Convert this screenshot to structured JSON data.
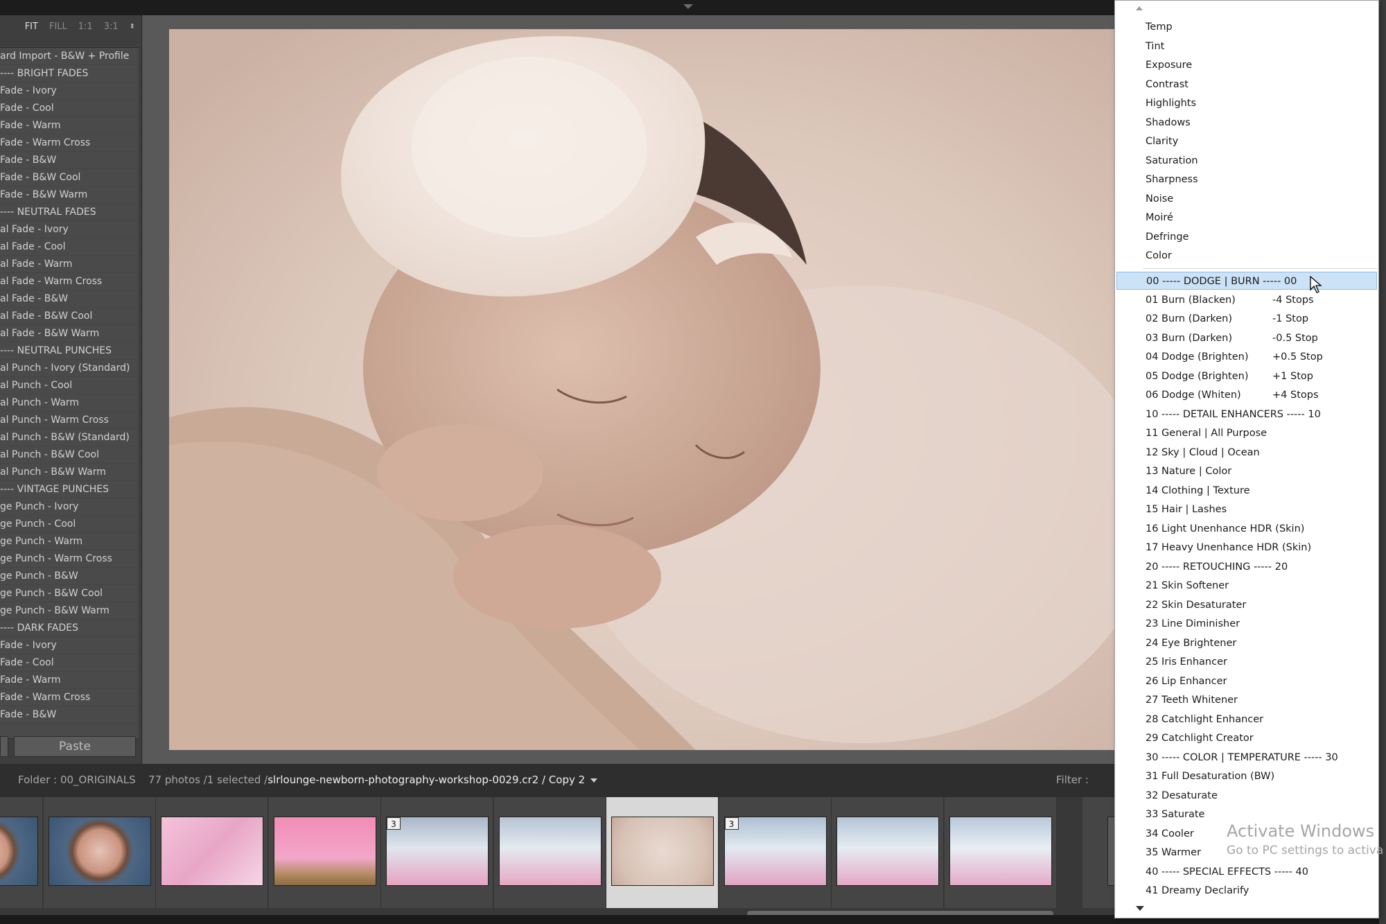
{
  "toolbar": {
    "zoom": [
      "FIT",
      "FILL",
      "1:1",
      "3:1"
    ],
    "zoom_active": "FIT"
  },
  "presets": [
    "ard Import - B&W + Profile",
    "---- BRIGHT FADES",
    "Fade - Ivory",
    "Fade - Cool",
    "Fade - Warm",
    "Fade - Warm Cross",
    "Fade - B&W",
    "Fade - B&W Cool",
    "Fade - B&W Warm",
    "---- NEUTRAL FADES",
    "al Fade - Ivory",
    "al Fade - Cool",
    "al Fade - Warm",
    "al Fade - Warm Cross",
    "al Fade - B&W",
    "al Fade - B&W Cool",
    "al Fade - B&W Warm",
    "---- NEUTRAL PUNCHES",
    "al Punch - Ivory (Standard)",
    "al Punch - Cool",
    "al Punch - Warm",
    "al Punch - Warm Cross",
    "al Punch - B&W (Standard)",
    "al Punch - B&W Cool",
    "al Punch - B&W Warm",
    "---- VINTAGE PUNCHES",
    "ge Punch - Ivory",
    "ge Punch - Cool",
    "ge Punch - Warm",
    "ge Punch - Warm Cross",
    "ge Punch - B&W",
    "ge Punch - B&W Cool",
    "ge Punch - B&W Warm",
    "---- DARK FADES",
    "Fade - Ivory",
    "Fade - Cool",
    "Fade - Warm",
    "Fade - Warm Cross",
    "Fade - B&W"
  ],
  "paste_label": "Paste",
  "status": {
    "folder": "Folder : 00_ORIGINALS",
    "count": "77 photos /1 selected /",
    "file": "slrlounge-newborn-photography-workshop-0029.cr2 / Copy 2",
    "filter": "Filter :"
  },
  "filmstrip": [
    {
      "badge": ""
    },
    {
      "badge": ""
    },
    {
      "badge": ""
    },
    {
      "badge": ""
    },
    {
      "badge": "3"
    },
    {
      "badge": ""
    },
    {
      "badge": "",
      "selected": true
    },
    {
      "badge": "3"
    },
    {
      "badge": ""
    },
    {
      "badge": ""
    }
  ],
  "menu": {
    "items": [
      {
        "label": "Temp",
        "value": ""
      },
      {
        "label": "Tint",
        "value": ""
      },
      {
        "label": "Exposure",
        "value": ""
      },
      {
        "label": "Contrast",
        "value": ""
      },
      {
        "label": "Highlights",
        "value": ""
      },
      {
        "label": "Shadows",
        "value": ""
      },
      {
        "label": "Clarity",
        "value": ""
      },
      {
        "label": "Saturation",
        "value": ""
      },
      {
        "label": "Sharpness",
        "value": ""
      },
      {
        "label": "Noise",
        "value": ""
      },
      {
        "label": "Moiré",
        "value": ""
      },
      {
        "label": "Defringe",
        "value": ""
      },
      {
        "label": "Color",
        "value": ""
      },
      {
        "label": "00 ----- DODGE | BURN ----- 00",
        "value": "",
        "highlighted": true
      },
      {
        "label": "01 Burn (Blacken)",
        "value": "-4 Stops"
      },
      {
        "label": "02 Burn (Darken)",
        "value": "-1 Stop"
      },
      {
        "label": "03 Burn (Darken)",
        "value": "-0.5 Stop"
      },
      {
        "label": "04 Dodge (Brighten)",
        "value": "+0.5 Stop"
      },
      {
        "label": "05 Dodge (Brighten)",
        "value": "+1 Stop"
      },
      {
        "label": "06 Dodge (Whiten)",
        "value": "+4 Stops"
      },
      {
        "label": "10 ----- DETAIL ENHANCERS ----- 10",
        "value": ""
      },
      {
        "label": "11 General | All Purpose",
        "value": ""
      },
      {
        "label": "12 Sky | Cloud | Ocean",
        "value": ""
      },
      {
        "label": "13 Nature | Color",
        "value": ""
      },
      {
        "label": "14 Clothing | Texture",
        "value": ""
      },
      {
        "label": "15 Hair | Lashes",
        "value": ""
      },
      {
        "label": "16 Light Unenhance HDR (Skin)",
        "value": ""
      },
      {
        "label": "17 Heavy Unenhance HDR (Skin)",
        "value": ""
      },
      {
        "label": "20 ----- RETOUCHING ----- 20",
        "value": ""
      },
      {
        "label": "21 Skin Softener",
        "value": ""
      },
      {
        "label": "22 Skin Desaturater",
        "value": ""
      },
      {
        "label": "23 Line Diminisher",
        "value": ""
      },
      {
        "label": "24 Eye Brightener",
        "value": ""
      },
      {
        "label": "25 Iris Enhancer",
        "value": ""
      },
      {
        "label": "26 Lip Enhancer",
        "value": ""
      },
      {
        "label": "27 Teeth Whitener",
        "value": ""
      },
      {
        "label": "28 Catchlight Enhancer",
        "value": ""
      },
      {
        "label": "29 Catchlight Creator",
        "value": ""
      },
      {
        "label": "30 ----- COLOR | TEMPERATURE ----- 30",
        "value": ""
      },
      {
        "label": "31 Full Desaturation (BW)",
        "value": ""
      },
      {
        "label": "32 Desaturate",
        "value": ""
      },
      {
        "label": "33 Saturate",
        "value": ""
      },
      {
        "label": "34 Cooler",
        "value": ""
      },
      {
        "label": "35 Warmer",
        "value": ""
      },
      {
        "label": "40 ----- SPECIAL EFFECTS ----- 40",
        "value": ""
      },
      {
        "label": "41 Dreamy Declarify",
        "value": ""
      }
    ]
  },
  "watermark": {
    "title": "Activate Windows",
    "subtitle": "Go to PC settings to activa"
  }
}
